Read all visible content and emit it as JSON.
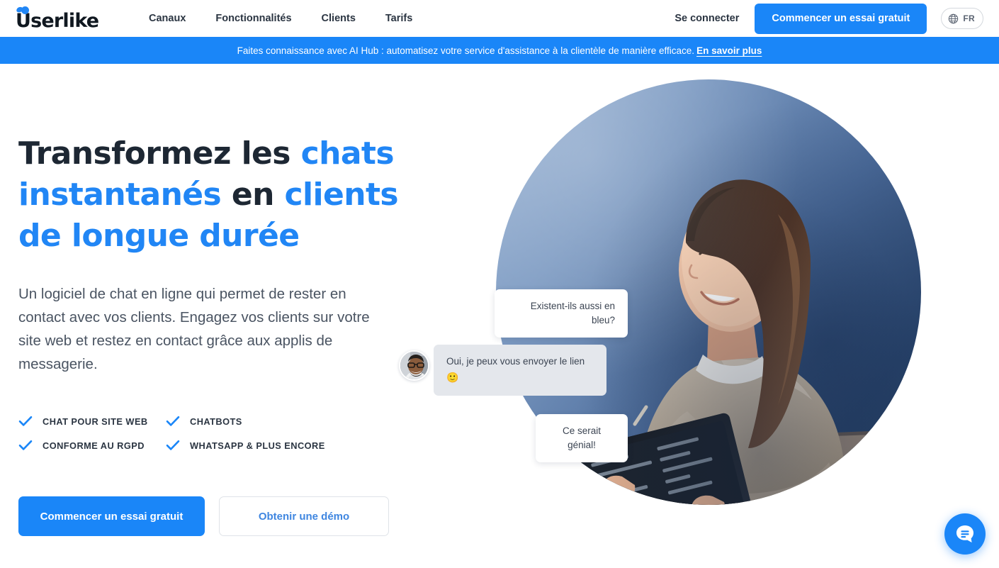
{
  "brand": {
    "name": "Userlike",
    "accent_blue": "#1a86f8",
    "headline_blue": "#2186f5",
    "text_dark": "#1d2733",
    "banner_blue": "#1a86f8",
    "circle_light": "#9db6d6",
    "circle_dark": "#2e4a72"
  },
  "header": {
    "logo_text": "Userlike",
    "nav": [
      {
        "label": "Canaux"
      },
      {
        "label": "Fonctionnalités"
      },
      {
        "label": "Clients"
      },
      {
        "label": "Tarifs"
      }
    ],
    "login_label": "Se connecter",
    "trial_label": "Commencer un essai gratuit",
    "language": {
      "code": "FR",
      "icon": "globe-icon"
    }
  },
  "banner": {
    "text": "Faites connaissance avec AI Hub : automatisez votre service d'assistance à la clientèle de manière efficace.",
    "link_label": "En savoir plus"
  },
  "hero": {
    "headline": {
      "part_1": "Transformez les ",
      "part_2_accent": "chats instantanés",
      "part_3": " en ",
      "part_4_accent": "clients de longue durée"
    },
    "subhead": "Un logiciel de chat en ligne qui permet de rester en contact avec vos clients. Engagez vos clients sur votre site web et restez en contact grâce aux applis de messagerie.",
    "features": [
      {
        "label": "CHAT POUR SITE WEB",
        "icon": "check-icon"
      },
      {
        "label": "CHATBOTS",
        "icon": "check-icon"
      },
      {
        "label": "CONFORME AU RGPD",
        "icon": "check-icon"
      },
      {
        "label": "WHATSAPP & PLUS ENCORE",
        "icon": "check-icon"
      }
    ],
    "cta_primary": "Commencer un essai gratuit",
    "cta_secondary": "Obtenir une démo",
    "image_alt": "Femme souriante tenant une tablette devant un cercle bleu"
  },
  "chat_preview": {
    "messages": [
      {
        "id": "bubble-1",
        "text": "Existent-ils aussi en bleu?",
        "side": "visitor",
        "style": "white"
      },
      {
        "id": "bubble-2",
        "text": "Oui, je peux vous envoyer le lien",
        "emoji": "🙂",
        "side": "operator",
        "style": "grey",
        "has_avatar": true
      },
      {
        "id": "bubble-3",
        "text": "Ce serait génial!",
        "side": "visitor",
        "style": "white"
      }
    ],
    "avatar_name": "operator-avatar"
  },
  "chat_widget": {
    "icon": "chat-bubble-icon",
    "color": "#1a86f8"
  }
}
